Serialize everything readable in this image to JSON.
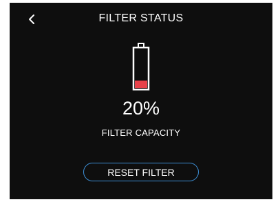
{
  "header": {
    "back_icon": "chevron-left-icon",
    "title": "FILTER STATUS"
  },
  "battery": {
    "icon": "battery-icon",
    "level_fraction": 0.2,
    "fill_color": "#e8424a",
    "outline_color": "#ffffff"
  },
  "status": {
    "percent_text": "20%",
    "caption": "FILTER CAPACITY"
  },
  "actions": {
    "reset_label": "RESET FILTER",
    "reset_border_color": "#3d8fd6"
  }
}
